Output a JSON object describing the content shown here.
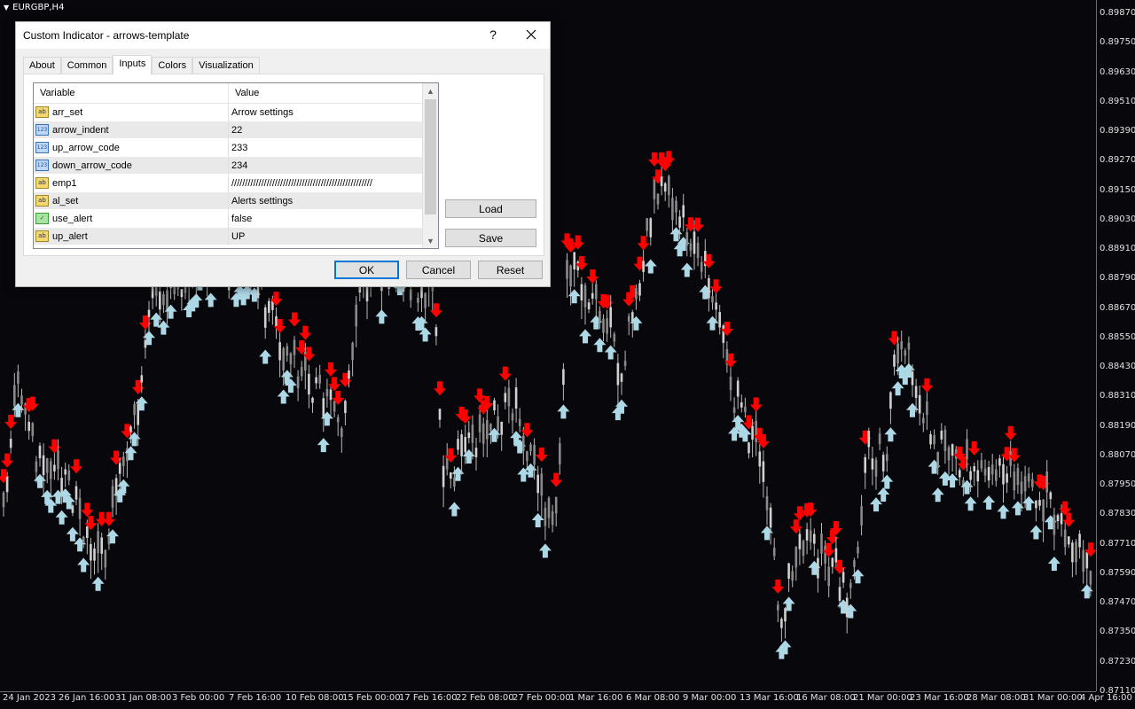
{
  "chart": {
    "symbol_title": "EURGBP,H4",
    "price_labels": [
      "0.89870",
      "0.89750",
      "0.89630",
      "0.89510",
      "0.89390",
      "0.89270",
      "0.89150",
      "0.89030",
      "0.88910",
      "0.88790",
      "0.88670",
      "0.88550",
      "0.88430",
      "0.88310",
      "0.88190",
      "0.88070",
      "0.87950",
      "0.87830",
      "0.87710",
      "0.87590",
      "0.87470",
      "0.87350",
      "0.87230",
      "0.87110"
    ],
    "time_labels": [
      "24 Jan 2023",
      "26 Jan 16:00",
      "31 Jan 08:00",
      "3 Feb 00:00",
      "7 Feb 16:00",
      "10 Feb 08:00",
      "15 Feb 00:00",
      "17 Feb 16:00",
      "22 Feb 08:00",
      "27 Feb 00:00",
      "1 Mar 16:00",
      "6 Mar 08:00",
      "9 Mar 00:00",
      "13 Mar 16:00",
      "16 Mar 08:00",
      "21 Mar 00:00",
      "23 Mar 16:00",
      "28 Mar 08:00",
      "31 Mar 00:00",
      "4 Apr 16:00"
    ],
    "colors": {
      "background": "#08080c",
      "candle": "#b8b8b8",
      "up_arrow": "#add8e6",
      "down_arrow": "#ff0000",
      "axis_text": "#e0e0e0"
    }
  },
  "dialog": {
    "title": "Custom Indicator - arrows-template",
    "help_label": "?",
    "close_icon": "close-icon",
    "tabs": [
      {
        "label": "About",
        "active": false
      },
      {
        "label": "Common",
        "active": false
      },
      {
        "label": "Inputs",
        "active": true
      },
      {
        "label": "Colors",
        "active": false
      },
      {
        "label": "Visualization",
        "active": false
      }
    ],
    "grid": {
      "col_variable": "Variable",
      "col_value": "Value",
      "rows": [
        {
          "type": "ab",
          "type_label": "ab",
          "name": "arr_set",
          "value": "Arrow settings"
        },
        {
          "type": "num",
          "type_label": "123",
          "name": "arrow_indent",
          "value": "22"
        },
        {
          "type": "num",
          "type_label": "123",
          "name": "up_arrow_code",
          "value": "233"
        },
        {
          "type": "num",
          "type_label": "123",
          "name": "down_arrow_code",
          "value": "234"
        },
        {
          "type": "ab",
          "type_label": "ab",
          "name": "emp1",
          "value": "////////////////////////////////////////////////////"
        },
        {
          "type": "ab",
          "type_label": "ab",
          "name": "al_set",
          "value": "Alerts settings"
        },
        {
          "type": "bool",
          "type_label": "✓",
          "name": "use_alert",
          "value": "false"
        },
        {
          "type": "ab",
          "type_label": "ab",
          "name": "up_alert",
          "value": "UP"
        }
      ]
    },
    "buttons": {
      "load": "Load",
      "save": "Save",
      "ok": "OK",
      "cancel": "Cancel",
      "reset": "Reset"
    }
  }
}
